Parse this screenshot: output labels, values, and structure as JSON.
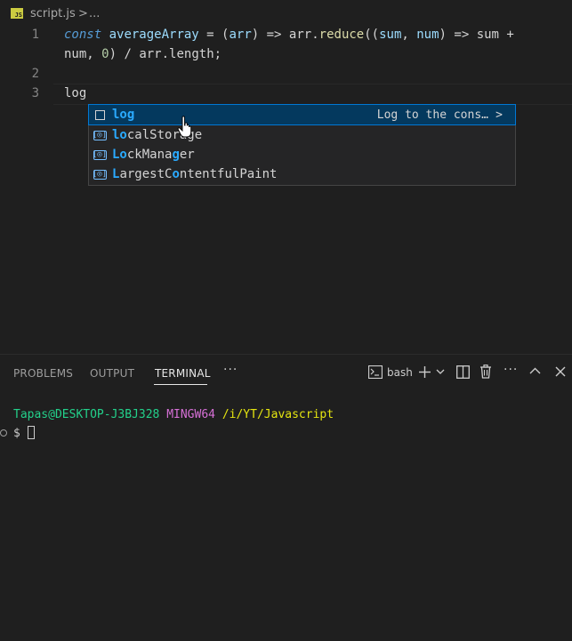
{
  "breadcrumb": {
    "file_icon": "JS",
    "file_name": "script.js",
    "separator": ">",
    "more": "..."
  },
  "editor": {
    "line_numbers": [
      "1",
      "2",
      "3"
    ],
    "line1": {
      "kw": "const",
      "name": "averageArray",
      "eq": " = (",
      "param": "arr",
      "arrow": ") => ",
      "obj": "arr",
      "dot": ".",
      "method": "reduce",
      "open": "((",
      "p1": "sum",
      "comma": ", ",
      "p2": "num",
      "arrow2": ") => ",
      "p3": "sum",
      "plus": " +"
    },
    "line1_wrap": {
      "p1": "num",
      "c1": ", ",
      "zero": "0",
      "c2": ") / ",
      "obj": "arr",
      "dot": ".",
      "prop": "length",
      "semi": ";"
    },
    "line3": "log"
  },
  "suggest": {
    "items": [
      {
        "kind": "snippet",
        "match": "log",
        "rest": "",
        "detail": "Log to the cons…",
        "more": ">"
      },
      {
        "kind": "variable",
        "pre": "",
        "match": "lo",
        "mid": "calSto",
        "match2": "",
        "rest": "rage"
      },
      {
        "kind": "variable",
        "pre": "",
        "match": "Lo",
        "mid": "ckMana",
        "match2": "g",
        "rest": "er"
      },
      {
        "kind": "variable",
        "pre": "",
        "match": "L",
        "mid": "argestC",
        "match2": "o",
        "rest": "ntentfulPaint"
      }
    ],
    "icon_names": [
      "snippet-icon",
      "variable-icon"
    ]
  },
  "panel": {
    "tabs": [
      "PROBLEMS",
      "OUTPUT",
      "TERMINAL"
    ],
    "active_tab": "TERMINAL",
    "more_tabs": "···",
    "terminal_name": "bash",
    "toolbar_icons": [
      "terminal-icon",
      "plus-icon",
      "chevron-down-icon",
      "split-icon",
      "trash-icon",
      "ellipsis-icon",
      "chevron-up-icon",
      "close-icon"
    ],
    "terminal": {
      "user": "Tapas@DESKTOP-J3BJ328",
      "host": "MINGW64",
      "path": "/i/YT/Javascript",
      "prompt": "$"
    }
  },
  "colors": {
    "editor_bg": "#1f1f1f",
    "selection": "#04395e",
    "match_highlight": "#2aaaff",
    "term_green": "#23d18b",
    "term_magenta": "#d670d6",
    "term_yellow": "#e5e510"
  }
}
